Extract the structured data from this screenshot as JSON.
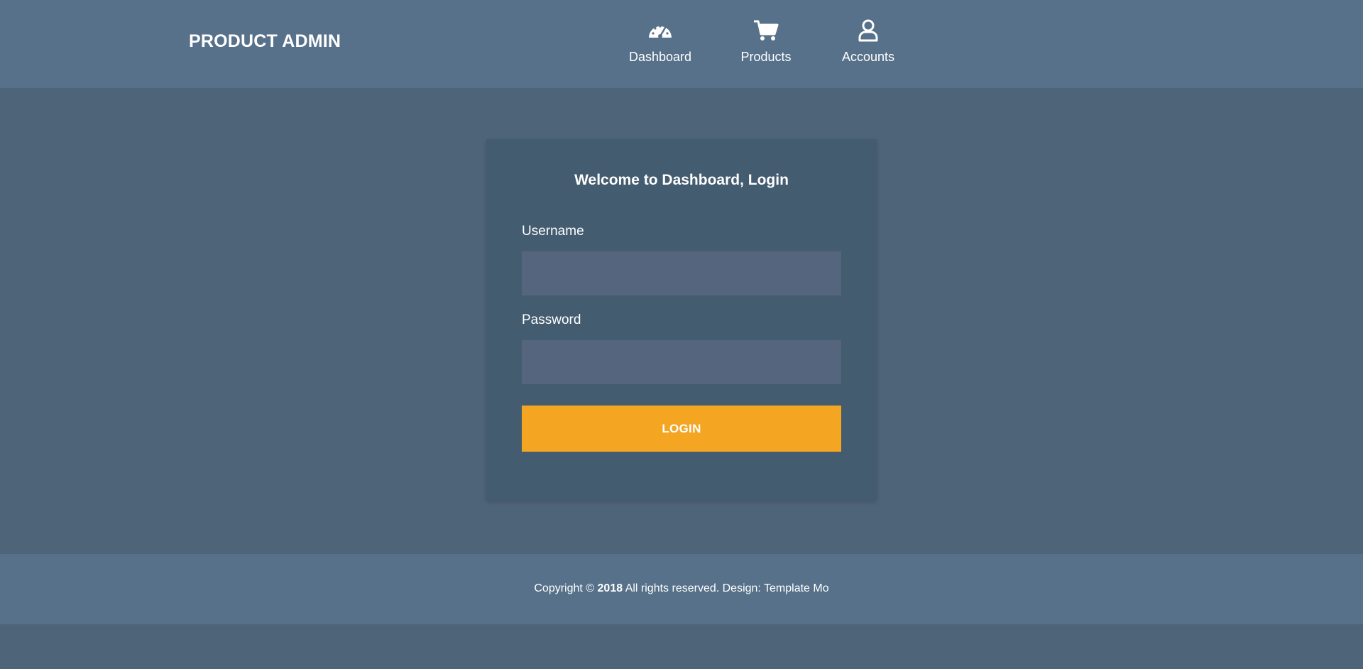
{
  "header": {
    "brand": "PRODUCT ADMIN",
    "nav": [
      {
        "label": "Dashboard",
        "icon": "speedometer-icon"
      },
      {
        "label": "Products",
        "icon": "shopping-cart-icon"
      },
      {
        "label": "Accounts",
        "icon": "user-icon"
      }
    ]
  },
  "login": {
    "title": "Welcome to Dashboard, Login",
    "username_label": "Username",
    "username_value": "",
    "password_label": "Password",
    "password_value": "",
    "button_label": "LOGIN"
  },
  "footer": {
    "prefix": "Copyright ©",
    "year": "2018",
    "suffix": "All rights reserved. Design: Template Mo"
  },
  "colors": {
    "page_bg": "#4e6479",
    "header_bg": "#567189",
    "card_bg": "#435c70",
    "input_bg": "#54657d",
    "accent": "#f4a623"
  }
}
